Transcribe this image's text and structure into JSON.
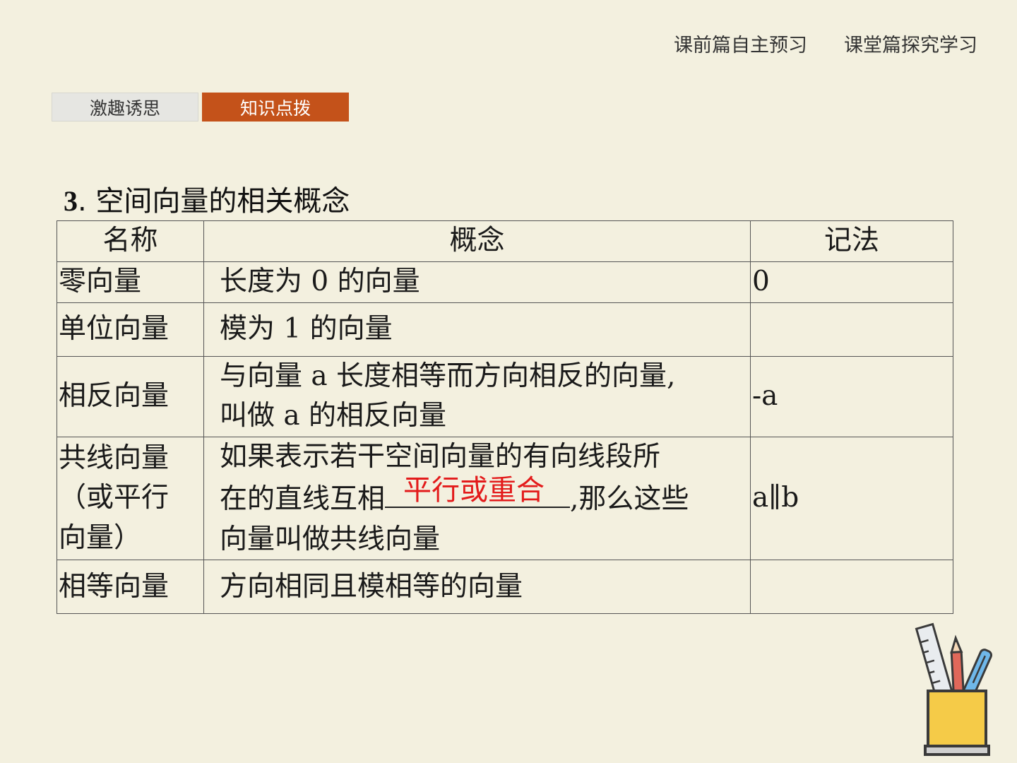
{
  "nav": {
    "items": [
      "课前篇自主预习",
      "课堂篇探究学习"
    ]
  },
  "tabs": {
    "items": [
      "激趣诱思",
      "知识点拨"
    ],
    "active_index": 1
  },
  "section": {
    "number": "3",
    "title": ". 空间向量的相关概念"
  },
  "table": {
    "headers": [
      "名称",
      "概念",
      "记法"
    ],
    "rows": [
      {
        "name": "零向量",
        "definition": "长度为 0 的向量",
        "notation": "0"
      },
      {
        "name": "单位向量",
        "definition": "模为 1 的向量",
        "notation": ""
      },
      {
        "name": "相反向量",
        "definition_line1": "与向量 a 长度相等而方向相反的向量,",
        "definition_line2": "叫做 a 的相反向量",
        "notation": "-a"
      },
      {
        "name_line1": "共线向量",
        "name_line2": "（或平行",
        "name_line3": "向量）",
        "definition_line1": "如果表示若干空间向量的有向线段所",
        "definition_pre": "在的直线互相",
        "answer": "平行或重合",
        "definition_post": ",那么这些",
        "definition_line3": "向量叫做共线向量",
        "notation": "a∥b"
      },
      {
        "name": "相等向量",
        "definition": "方向相同且模相等的向量",
        "notation": ""
      }
    ]
  },
  "colors": {
    "background": "#f3f0df",
    "tab_active": "#c4521a",
    "answer": "#e31b1b"
  }
}
